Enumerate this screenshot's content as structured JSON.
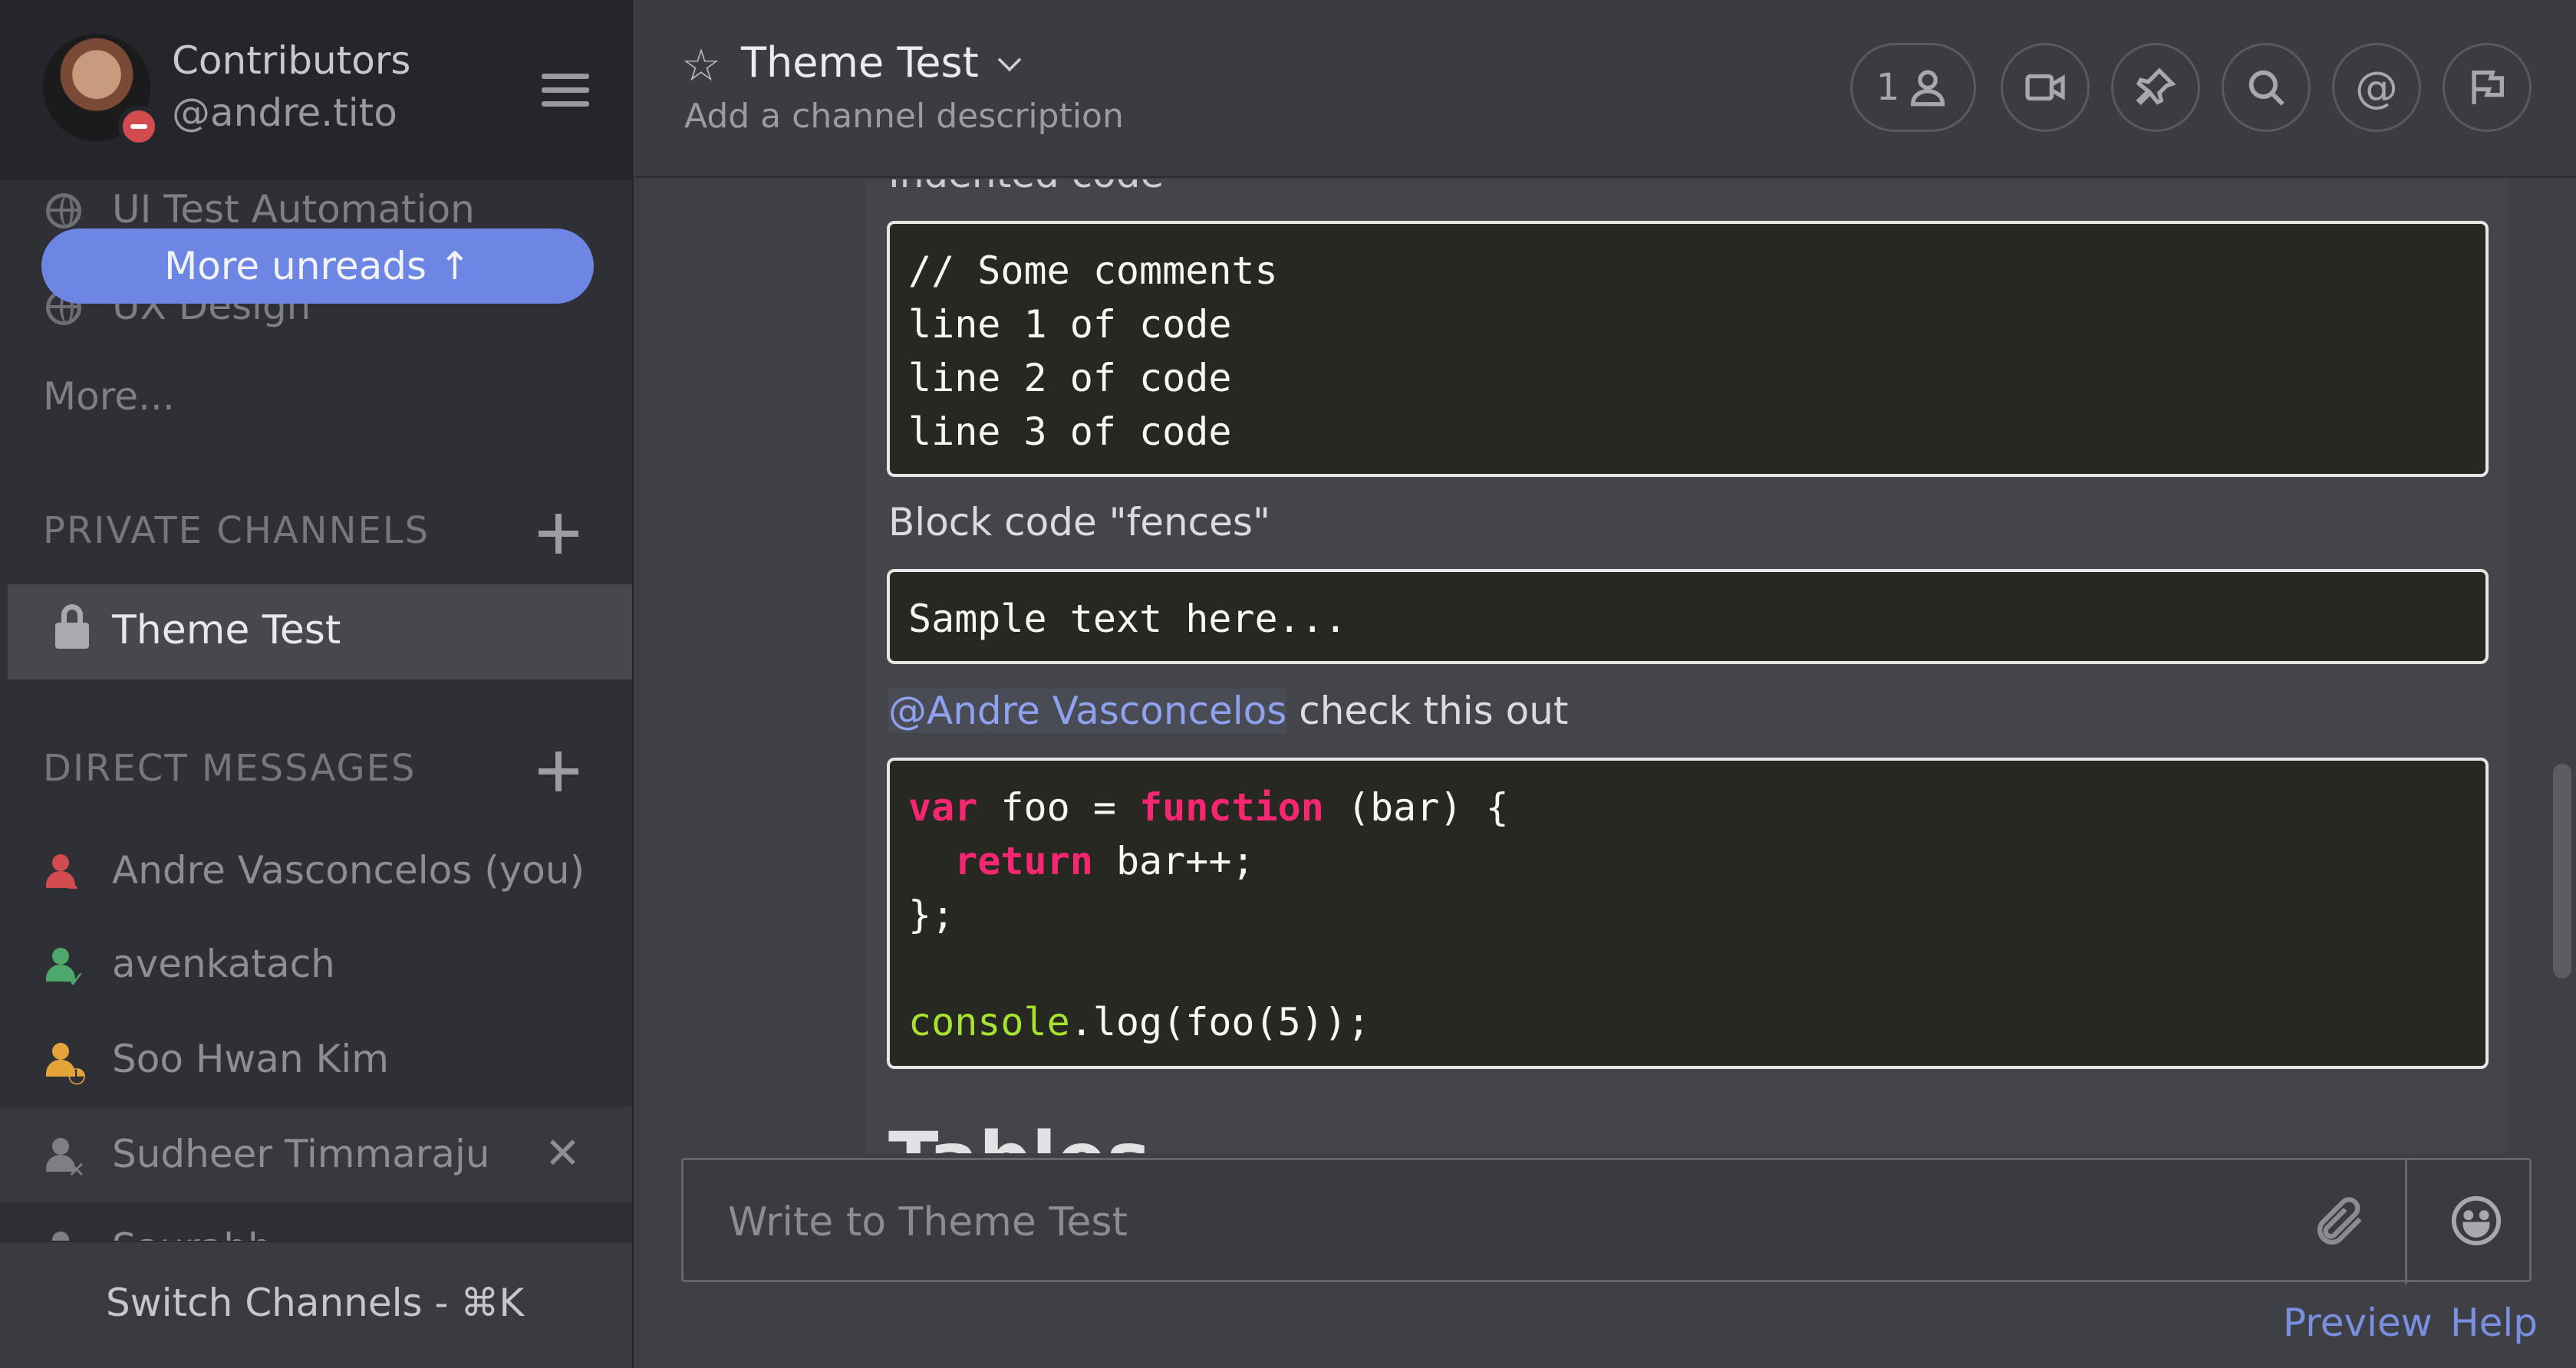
{
  "sidebar": {
    "team_name": "Contributors",
    "user_handle": "@andre.tito",
    "channels_partial": [
      "UI Test Automation",
      "UX Design"
    ],
    "more_unreads": "More unreads ↑",
    "more_link": "More...",
    "private_title": "PRIVATE CHANNELS",
    "private_channels": [
      {
        "label": "Theme Test",
        "icon": "lock-icon"
      }
    ],
    "dm_title": "DIRECT MESSAGES",
    "direct_messages": [
      {
        "label": "Andre Vasconcelos (you)",
        "status": "dnd",
        "color": "#d24b4e"
      },
      {
        "label": "avenkatach",
        "status": "online",
        "color": "#4ea86b"
      },
      {
        "label": "Soo Hwan Kim",
        "status": "away",
        "color": "#e4a43a"
      },
      {
        "label": "Sudheer Timmaraju",
        "status": "offline",
        "color": "#7e7f84"
      },
      {
        "label": "Saurabh",
        "status": "offline",
        "color": "#7e7f84"
      }
    ],
    "switch_channels": "Switch Channels - ⌘K"
  },
  "header": {
    "channel_title": "Theme Test",
    "channel_description": "Add a channel description",
    "member_count": "1",
    "icons": [
      "member-icon",
      "video-icon",
      "pin-icon",
      "search-icon",
      "mention-icon",
      "flag-icon"
    ]
  },
  "posts": {
    "partial_top": "Indented code",
    "indented_code": "// Some comments\nline 1 of code\nline 2 of code\nline 3 of code",
    "fences_label": "Block code \"fences\"",
    "fences_code": "Sample text here...",
    "mention_name": "@Andre Vasconcelos",
    "mention_text": " check this out",
    "js_code": {
      "line1": [
        "var",
        " foo = ",
        "function",
        " (bar) {"
      ],
      "line2": [
        "  ",
        "return",
        " bar++;"
      ],
      "line3": "};",
      "line5": [
        "console",
        ".log(foo(5));"
      ]
    },
    "tables_heading": "Tables"
  },
  "composer": {
    "placeholder": "Write to Theme Test"
  },
  "footer": {
    "preview": "Preview",
    "help": "Help"
  },
  "colors": {
    "accent": "#6e86e3",
    "link": "#7b8fe0",
    "code_bg": "#272822",
    "keyword": "#f92672",
    "builtin": "#a6e22e"
  }
}
